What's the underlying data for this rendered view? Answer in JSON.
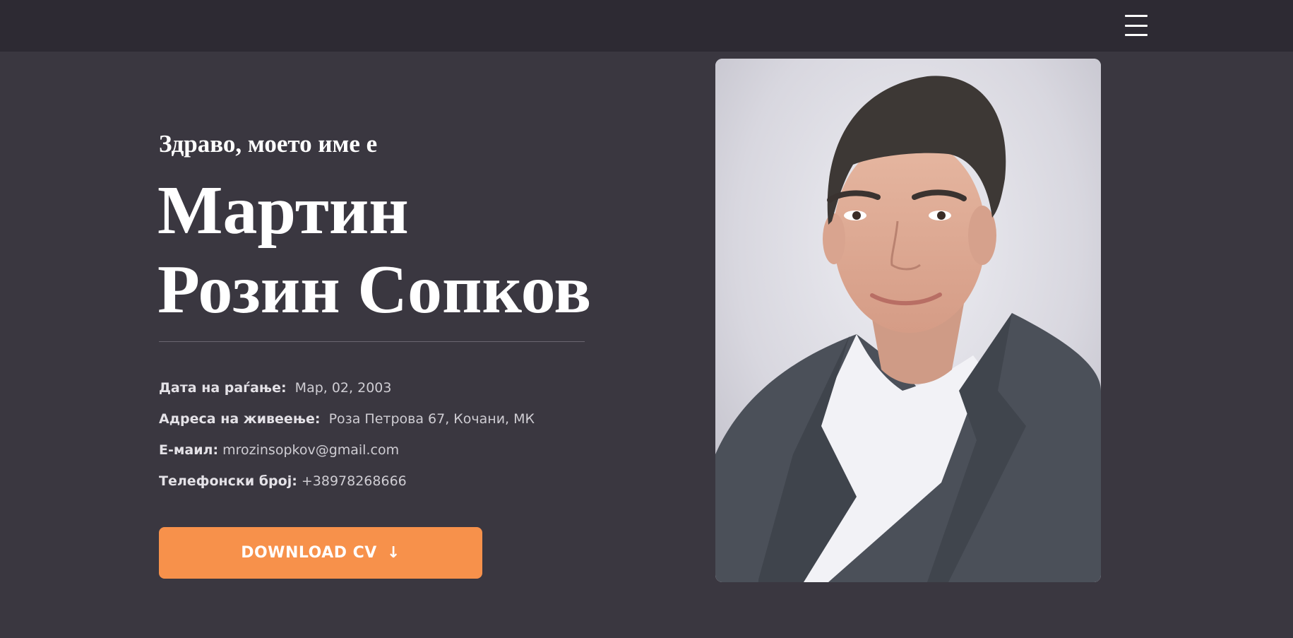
{
  "header": {
    "menu_icon": "hamburger-menu-icon"
  },
  "hero": {
    "greeting": "Здраво, моето име е",
    "name_line1": "Мартин",
    "name_line2": "Розин Сопков",
    "details": [
      {
        "label": "Дата на раѓање:",
        "value": "Мар, 02, 2003"
      },
      {
        "label": "Адреса на живеење:",
        "value": "Роза Петрова 67, Кочани, МК"
      },
      {
        "label": "Е-маил:",
        "value": "mrozinsopkov@gmail.com"
      },
      {
        "label": "Телефонски број:",
        "value": "+38978268666"
      }
    ],
    "download_label": "DOWNLOAD CV",
    "download_icon": "arrow-down-icon",
    "accent_color": "#f7914b"
  },
  "photo": {
    "description": "profile-portrait"
  }
}
